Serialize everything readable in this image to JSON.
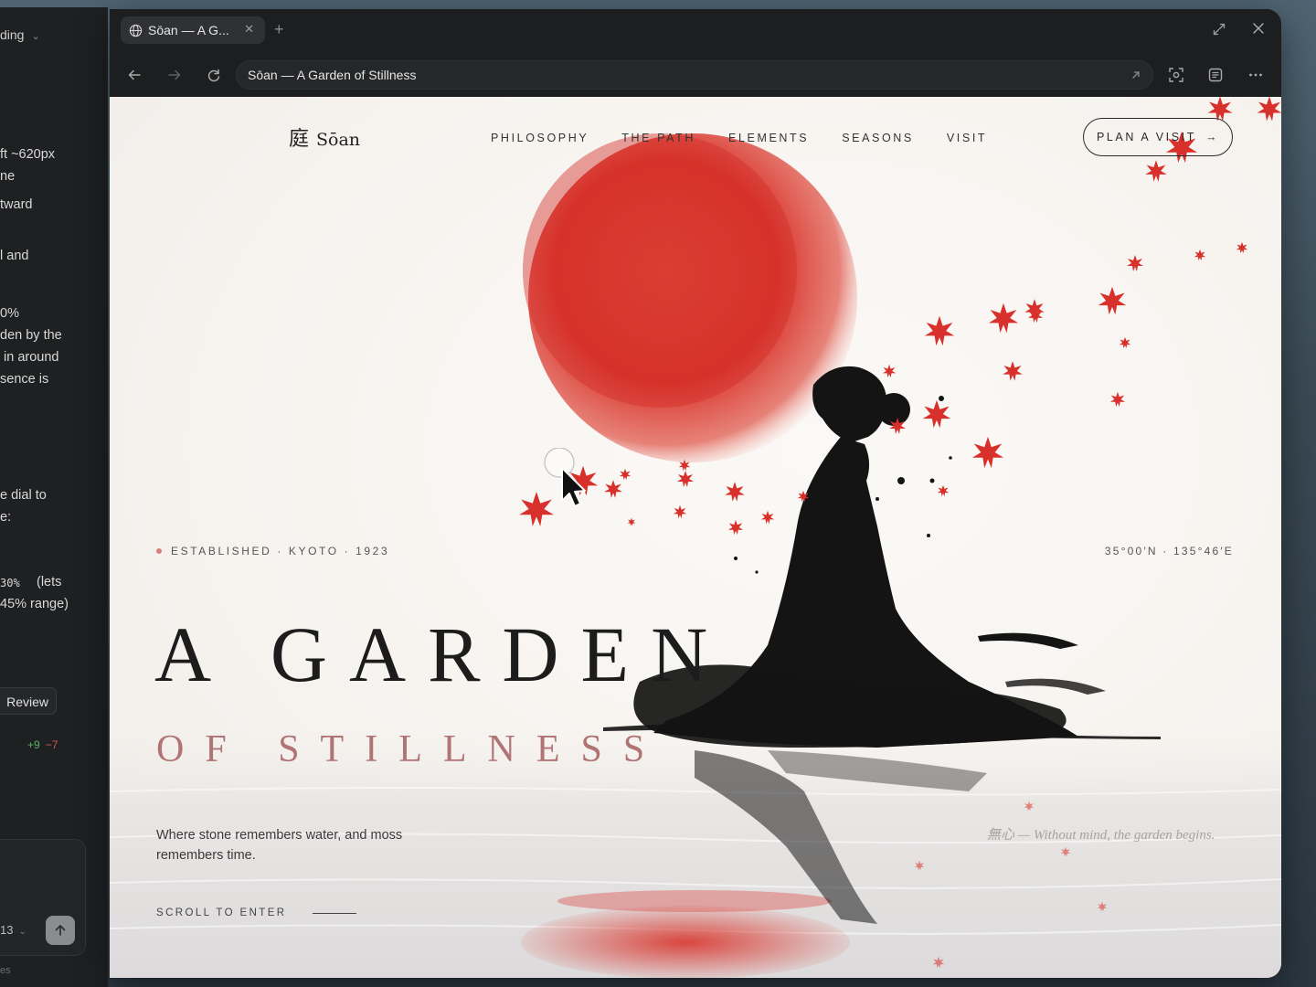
{
  "chat": {
    "header_label": "ding",
    "lines": [
      "ft ~620px",
      "ne",
      "tward",
      "l and",
      "0%",
      "den by the",
      "in around",
      "sence is",
      "e dial to",
      "e:",
      "30%",
      "(lets",
      "45% range)"
    ],
    "review_label": "Review",
    "diff_added": "+9",
    "diff_removed": "−7",
    "model_label": "13",
    "footer_label": "es"
  },
  "browser": {
    "tab_title": "Sōan — A G...",
    "address": "Sōan — A Garden of Stillness"
  },
  "site": {
    "logo_kanji": "庭",
    "logo_name": "Sōan",
    "nav": [
      "PHILOSOPHY",
      "THE PATH",
      "ELEMENTS",
      "SEASONS",
      "VISIT"
    ],
    "cta_label": "PLAN A VISIT",
    "cta_arrow": "→",
    "established": "ESTABLISHED · KYOTO · 1923",
    "coordinates": "35°00′N · 135°46′E",
    "headline_1": "A GARDEN",
    "headline_2": "OF STILLNESS",
    "tagline": "Where stone remembers water, and moss remembers time.",
    "scroll_label": "SCROLL TO ENTER",
    "quote": "無心 — Without mind, the garden begins."
  },
  "colors": {
    "accent_red": "#d9352d",
    "ink": "#1c1c1c",
    "subtitle_rose": "#b07474",
    "paper": "#f6f3ef"
  }
}
